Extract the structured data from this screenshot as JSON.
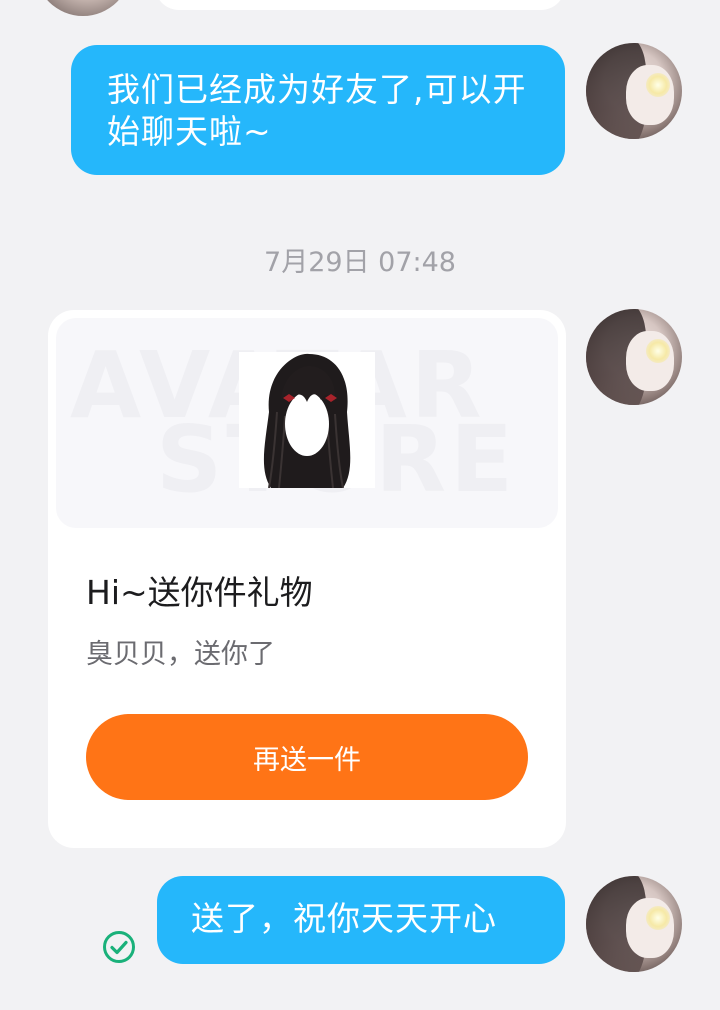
{
  "messages": [
    {
      "side": "right",
      "text": "我们已经成为好友了,可以开始聊天啦~"
    },
    {
      "type": "timestamp",
      "text": "7月29日 07:48"
    },
    {
      "type": "gift_card",
      "side": "right",
      "banner_watermark_top": "AVATAR",
      "banner_watermark_bottom": "STORE",
      "title": "Hi~送你件礼物",
      "subtitle": "臭贝贝，送你了",
      "button_label": "再送一件"
    },
    {
      "side": "right",
      "text": "送了，祝你天天开心",
      "status": "sent"
    }
  ],
  "colors": {
    "background": "#f2f2f4",
    "bubble_blue": "#25b7fb",
    "button_orange": "#ff7416",
    "check_green": "#1ab17a",
    "timestamp_gray": "#a2a2a8"
  },
  "icons": {
    "sent_status": "check-circle-icon"
  }
}
